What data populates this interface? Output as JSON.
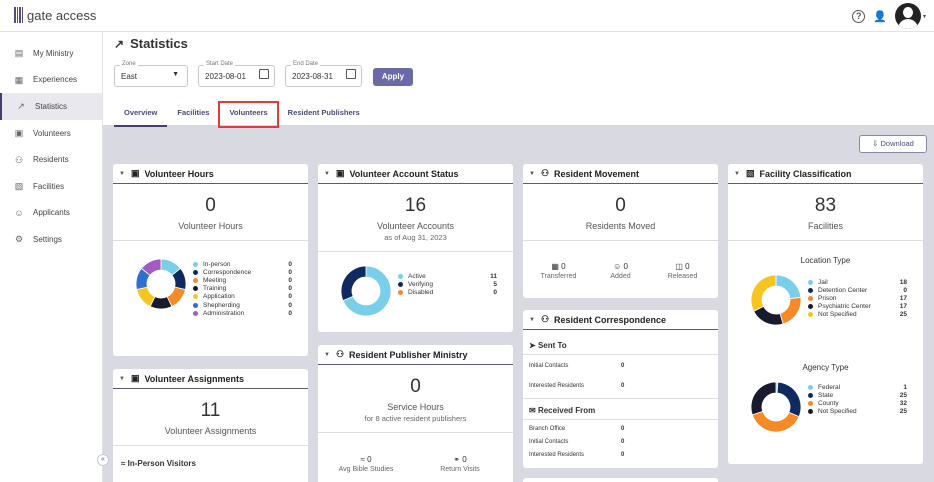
{
  "app": {
    "logo_text": "gate access"
  },
  "sidebar": {
    "items": [
      {
        "label": "My Ministry",
        "icon": "ministry-icon"
      },
      {
        "label": "Experiences",
        "icon": "experiences-icon"
      },
      {
        "label": "Statistics",
        "icon": "statistics-icon"
      },
      {
        "label": "Volunteers",
        "icon": "volunteers-icon"
      },
      {
        "label": "Residents",
        "icon": "residents-icon"
      },
      {
        "label": "Facilities",
        "icon": "facilities-icon"
      },
      {
        "label": "Applicants",
        "icon": "applicants-icon"
      },
      {
        "label": "Settings",
        "icon": "settings-icon"
      }
    ]
  },
  "page": {
    "title": "Statistics"
  },
  "filters": {
    "zone": {
      "label": "Zone",
      "value": "East"
    },
    "start_date": {
      "label": "Start Date",
      "value": "2023-08-01"
    },
    "end_date": {
      "label": "End Date",
      "value": "2023-08-31"
    },
    "apply_label": "Apply"
  },
  "tabs": [
    {
      "label": "Overview"
    },
    {
      "label": "Facilities"
    },
    {
      "label": "Volunteers"
    },
    {
      "label": "Resident Publishers"
    }
  ],
  "download_label": "Download",
  "volunteer_hours": {
    "title": "Volunteer Hours",
    "value": "0",
    "subtitle": "Volunteer Hours",
    "legend": [
      {
        "label": "In-person",
        "value": "0",
        "color": "#79cfea"
      },
      {
        "label": "Correspondence",
        "value": "0",
        "color": "#0e2a5e"
      },
      {
        "label": "Meeting",
        "value": "0",
        "color": "#f58a26"
      },
      {
        "label": "Training",
        "value": "0",
        "color": "#1a1a2e"
      },
      {
        "label": "Application",
        "value": "0",
        "color": "#f6c51f"
      },
      {
        "label": "Shepherding",
        "value": "0",
        "color": "#2f6fcf"
      },
      {
        "label": "Administration",
        "value": "0",
        "color": "#a05cc4"
      }
    ]
  },
  "volunteer_account_status": {
    "title": "Volunteer Account Status",
    "value": "16",
    "subtitle": "Volunteer Accounts",
    "subtitle2": "as of Aug 31, 2023",
    "legend": [
      {
        "label": "Active",
        "value": "11",
        "color": "#79cfea"
      },
      {
        "label": "Verifying",
        "value": "5",
        "color": "#0e2a5e"
      },
      {
        "label": "Disabled",
        "value": "0",
        "color": "#f58a26"
      }
    ]
  },
  "resident_movement": {
    "title": "Resident Movement",
    "value": "0",
    "subtitle": "Residents Moved",
    "stats": [
      {
        "value": "0",
        "label": "Transferred",
        "icon": "transfer-icon"
      },
      {
        "value": "0",
        "label": "Added",
        "icon": "add-person-icon"
      },
      {
        "value": "0",
        "label": "Released",
        "icon": "release-icon"
      }
    ]
  },
  "facility_classification": {
    "title": "Facility Classification",
    "value": "83",
    "subtitle": "Facilities",
    "location_title": "Location Type",
    "location_legend": [
      {
        "label": "Jail",
        "value": "18",
        "color": "#79cfea"
      },
      {
        "label": "Detention Center",
        "value": "0",
        "color": "#0e2a5e"
      },
      {
        "label": "Prison",
        "value": "17",
        "color": "#f58a26"
      },
      {
        "label": "Psychiatric Center",
        "value": "17",
        "color": "#1a1a2e"
      },
      {
        "label": "Not Specified",
        "value": "25",
        "color": "#f6c51f"
      }
    ],
    "agency_title": "Agency Type",
    "agency_legend": [
      {
        "label": "Federal",
        "value": "1",
        "color": "#79cfea"
      },
      {
        "label": "State",
        "value": "25",
        "color": "#0e2a5e"
      },
      {
        "label": "County",
        "value": "32",
        "color": "#f58a26"
      },
      {
        "label": "Not Specified",
        "value": "25",
        "color": "#1a1a2e"
      }
    ]
  },
  "resident_publisher_ministry": {
    "title": "Resident Publisher Ministry",
    "value": "0",
    "subtitle": "Service Hours",
    "subtitle2": "for 8 active resident publishers",
    "stats": [
      {
        "value": "0",
        "label": "Avg Bible Studies",
        "icon": "bible-study-icon"
      },
      {
        "value": "0",
        "label": "Return Visits",
        "icon": "return-visit-icon"
      }
    ]
  },
  "resident_correspondence": {
    "title": "Resident Correspondence",
    "sent_title": "Sent To",
    "sent": [
      {
        "label": "Initial Contacts",
        "value": "0"
      },
      {
        "label": "Interested Residents",
        "value": "0"
      }
    ],
    "received_title": "Received From",
    "received": [
      {
        "label": "Branch Office",
        "value": "0"
      },
      {
        "label": "Initial Contacts",
        "value": "0"
      },
      {
        "label": "Interested Residents",
        "value": "0"
      }
    ]
  },
  "volunteer_assignments": {
    "title": "Volunteer Assignments",
    "value": "11",
    "subtitle": "Volunteer Assignments",
    "inperson_title": "In-Person Visitors"
  }
}
